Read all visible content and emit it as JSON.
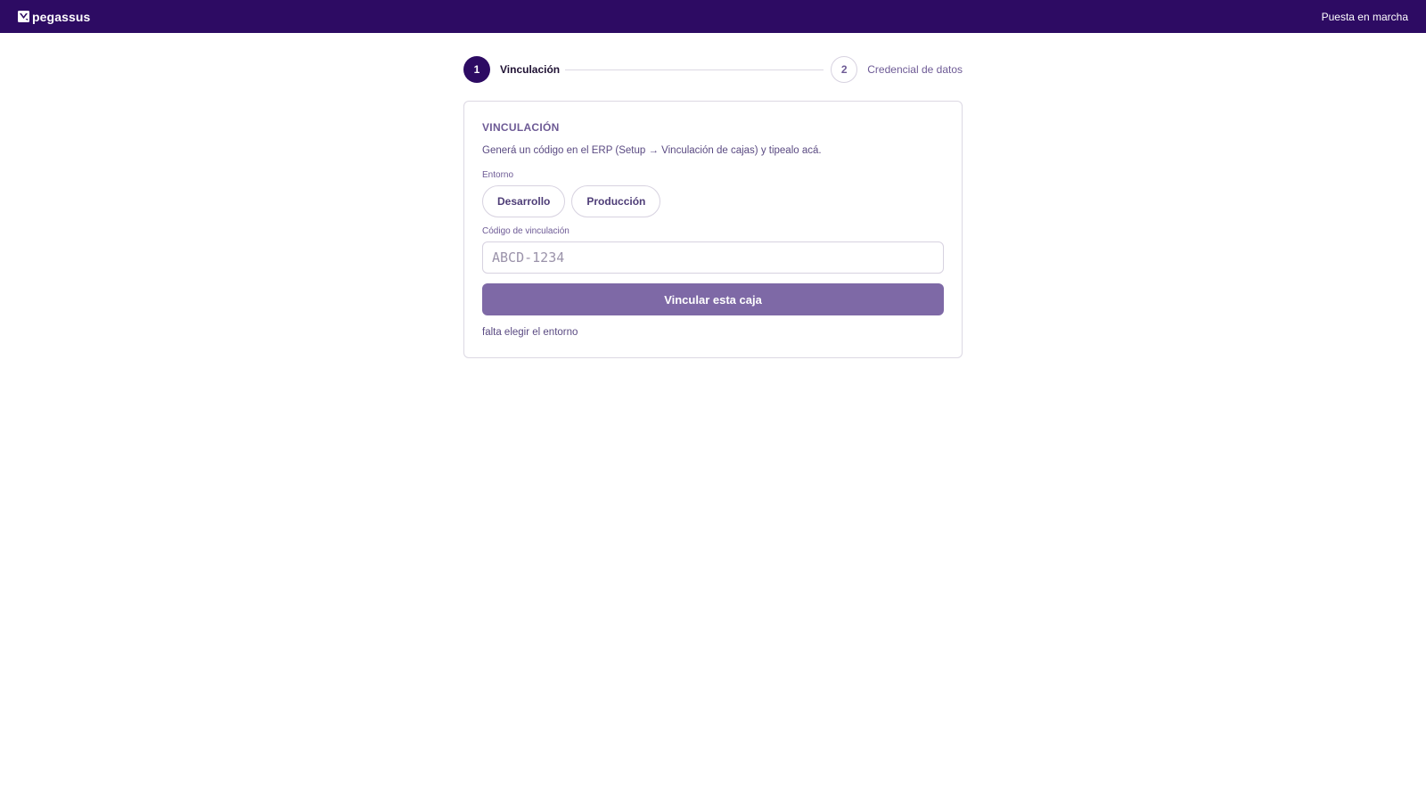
{
  "topbar": {
    "brand": "pegassus",
    "right_label": "Puesta en marcha"
  },
  "stepper": {
    "steps": [
      {
        "number": "1",
        "label": "Vinculación",
        "state": "active"
      },
      {
        "number": "2",
        "label": "Credencial de datos",
        "state": "inactive"
      }
    ]
  },
  "card": {
    "title": "VINCULACIÓN",
    "description": "Generá un código en el ERP (Setup → Vinculación de cajas) y tipealo acá.",
    "env_label": "Entorno",
    "env_options": [
      "Desarrollo",
      "Producción"
    ],
    "code_label": "Código de vinculación",
    "code_placeholder": "ABCD-1234",
    "code_value": "",
    "submit_label": "Vincular esta caja",
    "hint": "falta elegir el entorno"
  },
  "colors": {
    "brand": "#2d0b63",
    "button": "#7e69a6",
    "muted_text": "#6d5a95",
    "border": "#dcd8e3"
  },
  "icons": {
    "brand_logo": "pegassus-logo-icon"
  }
}
